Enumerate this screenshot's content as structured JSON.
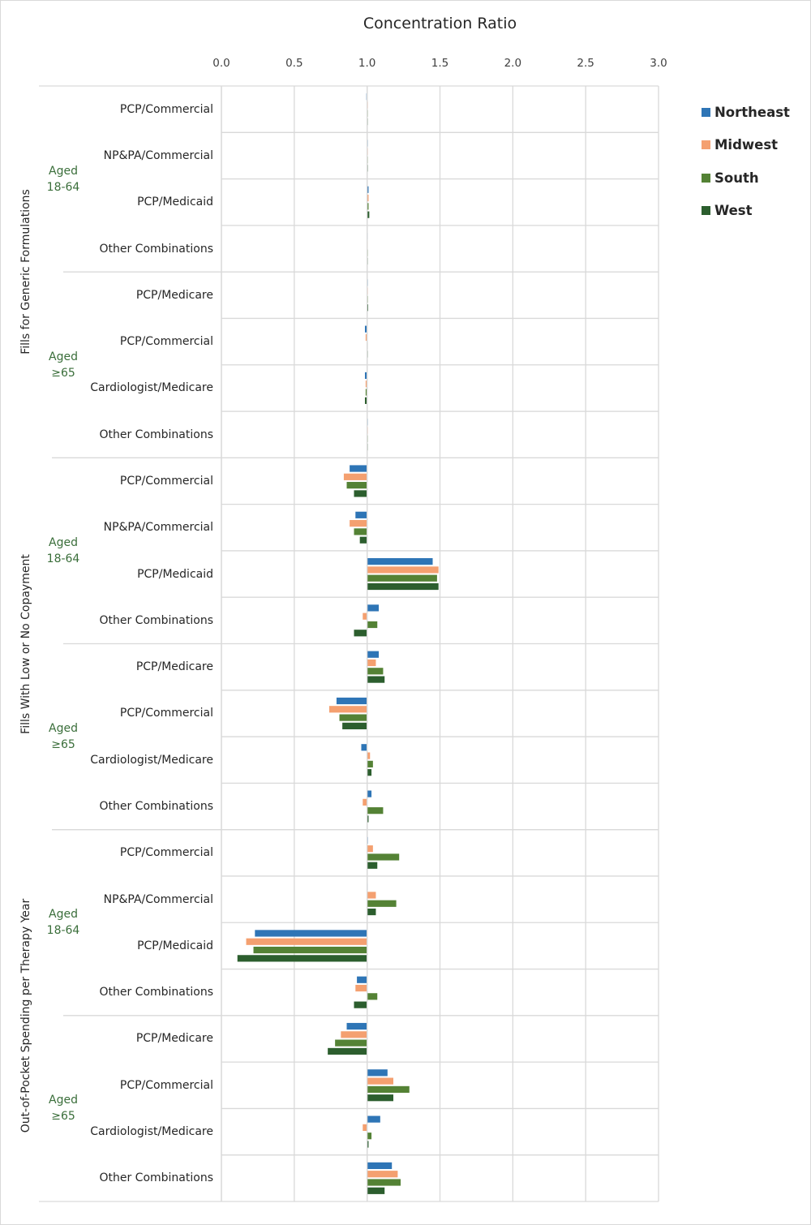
{
  "chart_data": {
    "type": "bar",
    "orientation": "horizontal",
    "title": "Concentration Ratio",
    "xlabel": "Concentration Ratio",
    "ylabel": "",
    "xlim": [
      0.0,
      3.0
    ],
    "baseline": 1.0,
    "x_ticks": [
      "0.0",
      "0.5",
      "1.0",
      "1.5",
      "2.0",
      "2.5",
      "3.0"
    ],
    "grid": true,
    "legend_position": "right",
    "series": [
      {
        "name": "Northeast",
        "color": "#2E75B6"
      },
      {
        "name": "Midwest",
        "color": "#F4A070"
      },
      {
        "name": "South",
        "color": "#548235"
      },
      {
        "name": "West",
        "color": "#2C5E2E"
      }
    ],
    "sections": [
      {
        "label": "Fills for Generic Formulations",
        "groups": [
          {
            "label_line1": "Aged",
            "label_line2": "18-64",
            "categories": [
              {
                "label": "PCP/Commercial",
                "values": [
                  0.995,
                  1.0,
                  1.0,
                  1.0
                ]
              },
              {
                "label": "NP&PA/Commercial",
                "values": [
                  1.0,
                  1.0,
                  1.0,
                  1.005
                ]
              },
              {
                "label": "PCP/Medicaid",
                "values": [
                  1.01,
                  1.01,
                  1.01,
                  1.015
                ]
              },
              {
                "label": "Other Combinations",
                "values": [
                  0.998,
                  0.998,
                  1.0,
                  1.0
                ]
              }
            ]
          },
          {
            "label_line1": "Aged",
            "label_line2": "≥65",
            "categories": [
              {
                "label": "PCP/Medicare",
                "values": [
                  1.0,
                  1.003,
                  1.005,
                  1.007
                ]
              },
              {
                "label": "PCP/Commercial",
                "values": [
                  0.985,
                  0.99,
                  0.998,
                  1.0
                ]
              },
              {
                "label": "Cardiologist/Medicare",
                "values": [
                  0.985,
                  0.99,
                  0.99,
                  0.985
                ]
              },
              {
                "label": "Other Combinations",
                "values": [
                  1.0,
                  1.0,
                  1.0,
                  1.0
                ]
              }
            ]
          }
        ]
      },
      {
        "label": "Fills With Low or No Copayment",
        "groups": [
          {
            "label_line1": "Aged",
            "label_line2": "18-64",
            "categories": [
              {
                "label": "PCP/Commercial",
                "values": [
                  0.88,
                  0.84,
                  0.86,
                  0.91
                ]
              },
              {
                "label": "NP&PA/Commercial",
                "values": [
                  0.92,
                  0.88,
                  0.91,
                  0.95
                ]
              },
              {
                "label": "PCP/Medicaid",
                "values": [
                  1.45,
                  1.49,
                  1.48,
                  1.49
                ]
              },
              {
                "label": "Other Combinations",
                "values": [
                  1.08,
                  0.97,
                  1.07,
                  0.91
                ]
              }
            ]
          },
          {
            "label_line1": "Aged",
            "label_line2": "≥65",
            "categories": [
              {
                "label": "PCP/Medicare",
                "values": [
                  1.08,
                  1.06,
                  1.11,
                  1.12
                ]
              },
              {
                "label": "PCP/Commercial",
                "values": [
                  0.79,
                  0.74,
                  0.81,
                  0.83
                ]
              },
              {
                "label": "Cardiologist/Medicare",
                "values": [
                  0.96,
                  1.02,
                  1.04,
                  1.03
                ]
              },
              {
                "label": "Other Combinations",
                "values": [
                  1.03,
                  0.97,
                  1.11,
                  1.01
                ]
              }
            ]
          }
        ]
      },
      {
        "label": "Out-of-Pocket Spending per Therapy Year",
        "groups": [
          {
            "label_line1": "Aged",
            "label_line2": "18-64",
            "categories": [
              {
                "label": "PCP/Commercial",
                "values": [
                  1.005,
                  1.04,
                  1.22,
                  1.07
                ]
              },
              {
                "label": "NP&PA/Commercial",
                "values": [
                  0.998,
                  1.06,
                  1.2,
                  1.06
                ]
              },
              {
                "label": "PCP/Medicaid",
                "values": [
                  0.23,
                  0.17,
                  0.22,
                  0.11
                ]
              },
              {
                "label": "Other Combinations",
                "values": [
                  0.93,
                  0.92,
                  1.07,
                  0.91
                ]
              }
            ]
          },
          {
            "label_line1": "Aged",
            "label_line2": "≥65",
            "categories": [
              {
                "label": "PCP/Medicare",
                "values": [
                  0.86,
                  0.82,
                  0.78,
                  0.73
                ]
              },
              {
                "label": "PCP/Commercial",
                "values": [
                  1.14,
                  1.18,
                  1.29,
                  1.18
                ]
              },
              {
                "label": "Cardiologist/Medicare",
                "values": [
                  1.09,
                  0.97,
                  1.03,
                  1.01
                ]
              },
              {
                "label": "Other Combinations",
                "values": [
                  1.17,
                  1.21,
                  1.23,
                  1.12
                ]
              }
            ]
          }
        ]
      }
    ]
  }
}
